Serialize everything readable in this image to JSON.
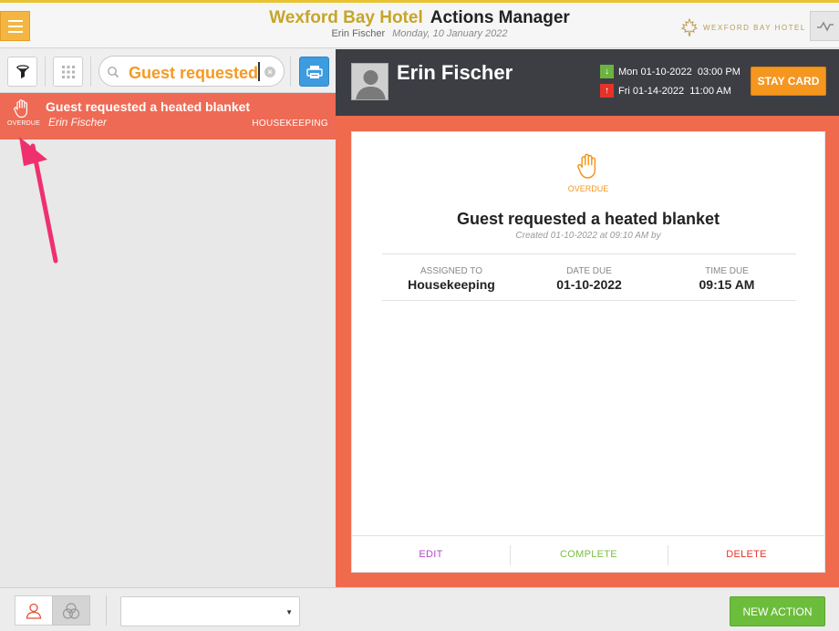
{
  "header": {
    "hotel_name": "Wexford Bay Hotel",
    "app_name": "Actions Manager",
    "user": "Erin Fischer",
    "date": "Monday, 10 January 2022",
    "brand_text": "WEXFORD BAY HOTEL"
  },
  "search": {
    "value": "Guest requested"
  },
  "actions": [
    {
      "status": "OVERDUE",
      "title": "Guest requested a heated blanket",
      "guest": "Erin Fischer",
      "department": "HOUSEKEEPING"
    }
  ],
  "guest_panel": {
    "name": "Erin Fischer",
    "arrival": "Mon 01-10-2022  03:00 PM",
    "departure": "Fri 01-14-2022  11:00 AM",
    "stay_card_label": "STAY CARD"
  },
  "detail": {
    "status": "OVERDUE",
    "title": "Guest requested a heated blanket",
    "created": "Created 01-10-2022 at 09:10 AM by",
    "assigned_label": "ASSIGNED TO",
    "assigned_value": "Housekeeping",
    "date_due_label": "DATE DUE",
    "date_due_value": "01-10-2022",
    "time_due_label": "TIME DUE",
    "time_due_value": "09:15 AM",
    "edit_label": "EDIT",
    "complete_label": "COMPLETE",
    "delete_label": "DELETE"
  },
  "bottom": {
    "new_action_label": "NEW ACTION",
    "dropdown_value": ""
  },
  "colors": {
    "accent_gold": "#c6a52a",
    "overdue_red": "#ee6a54",
    "orange": "#f5961f",
    "green": "#6dbd3c",
    "edit_purple": "#b04ac2",
    "complete_green": "#7dbd44",
    "delete_red": "#e5332a",
    "annotation_pink": "#f0306e"
  }
}
